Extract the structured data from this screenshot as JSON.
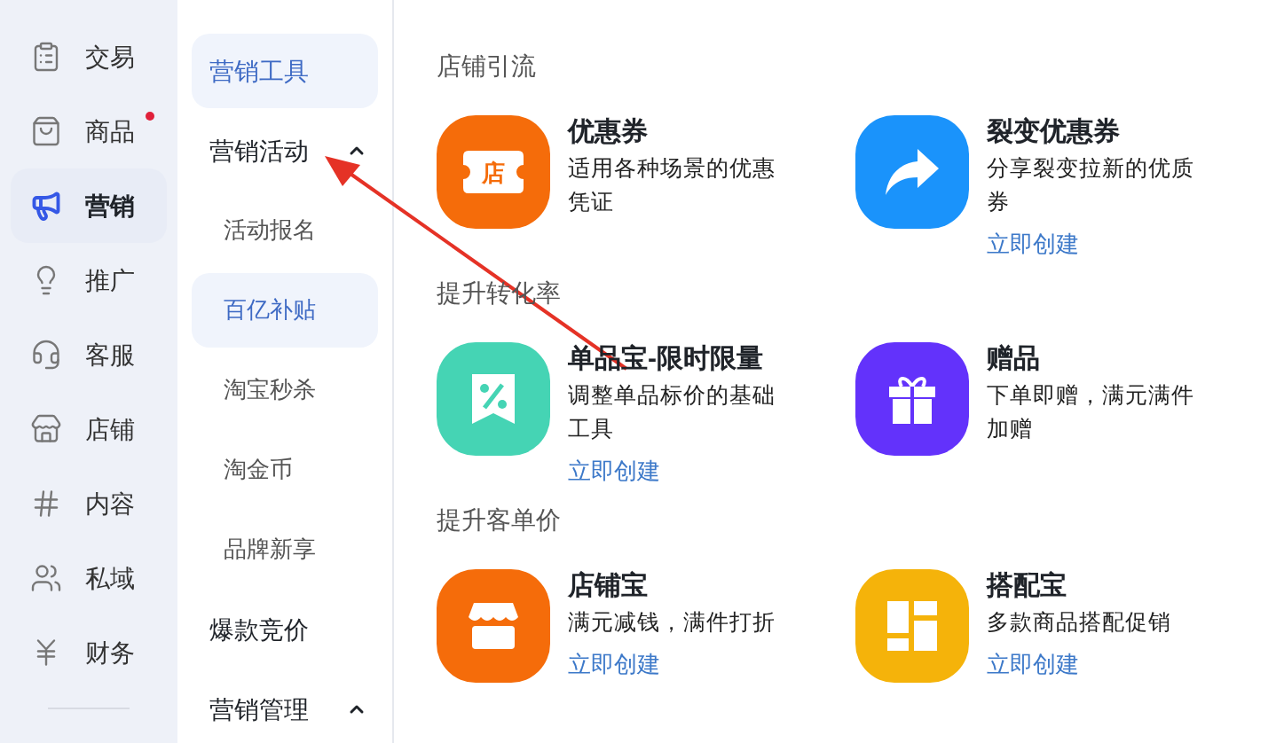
{
  "nav": [
    {
      "label": "交易",
      "selected": false,
      "dot": false
    },
    {
      "label": "商品",
      "selected": false,
      "dot": true
    },
    {
      "label": "营销",
      "selected": true,
      "dot": false
    },
    {
      "label": "推广",
      "selected": false,
      "dot": false
    },
    {
      "label": "客服",
      "selected": false,
      "dot": false
    },
    {
      "label": "店铺",
      "selected": false,
      "dot": false
    },
    {
      "label": "内容",
      "selected": false,
      "dot": false
    },
    {
      "label": "私域",
      "selected": false,
      "dot": false
    },
    {
      "label": "财务",
      "selected": false,
      "dot": false
    }
  ],
  "submenu": [
    {
      "label": "营销工具",
      "selected": true
    },
    {
      "label": "营销活动",
      "selected": false,
      "expanded": true,
      "children": [
        {
          "label": "活动报名",
          "selected": false
        },
        {
          "label": "百亿补贴",
          "selected": true
        },
        {
          "label": "淘宝秒杀",
          "selected": false
        },
        {
          "label": "淘金币",
          "selected": false
        },
        {
          "label": "品牌新享",
          "selected": false
        }
      ]
    },
    {
      "label": "爆款竞价",
      "selected": false
    },
    {
      "label": "营销管理",
      "selected": false,
      "expanded": true
    }
  ],
  "sections": [
    {
      "title": "店铺引流",
      "tools": [
        {
          "name": "优惠券",
          "desc": "适用各种场景的优惠凭证",
          "icon_text": "店",
          "color": "#f56c0a"
        },
        {
          "name": "裂变优惠券",
          "desc": "分享裂变拉新的优质券",
          "color": "#1a93fb",
          "link": "立即创建"
        }
      ]
    },
    {
      "title": "提升转化率",
      "tools": [
        {
          "name": "单品宝-限时限量",
          "desc": "调整单品标价的基础工具",
          "color": "#45d4b4",
          "link": "立即创建"
        },
        {
          "name": "赠品",
          "desc": "下单即赠，满元满件加赠",
          "color": "#6332fb"
        }
      ]
    },
    {
      "title": "提升客单价",
      "tools": [
        {
          "name": "店铺宝",
          "desc": "满元减钱，满件打折",
          "color": "#f56c0a",
          "link": "立即创建"
        },
        {
          "name": "搭配宝",
          "desc": "多款商品搭配促销",
          "color": "#f5b30a",
          "link": "立即创建"
        }
      ]
    }
  ]
}
